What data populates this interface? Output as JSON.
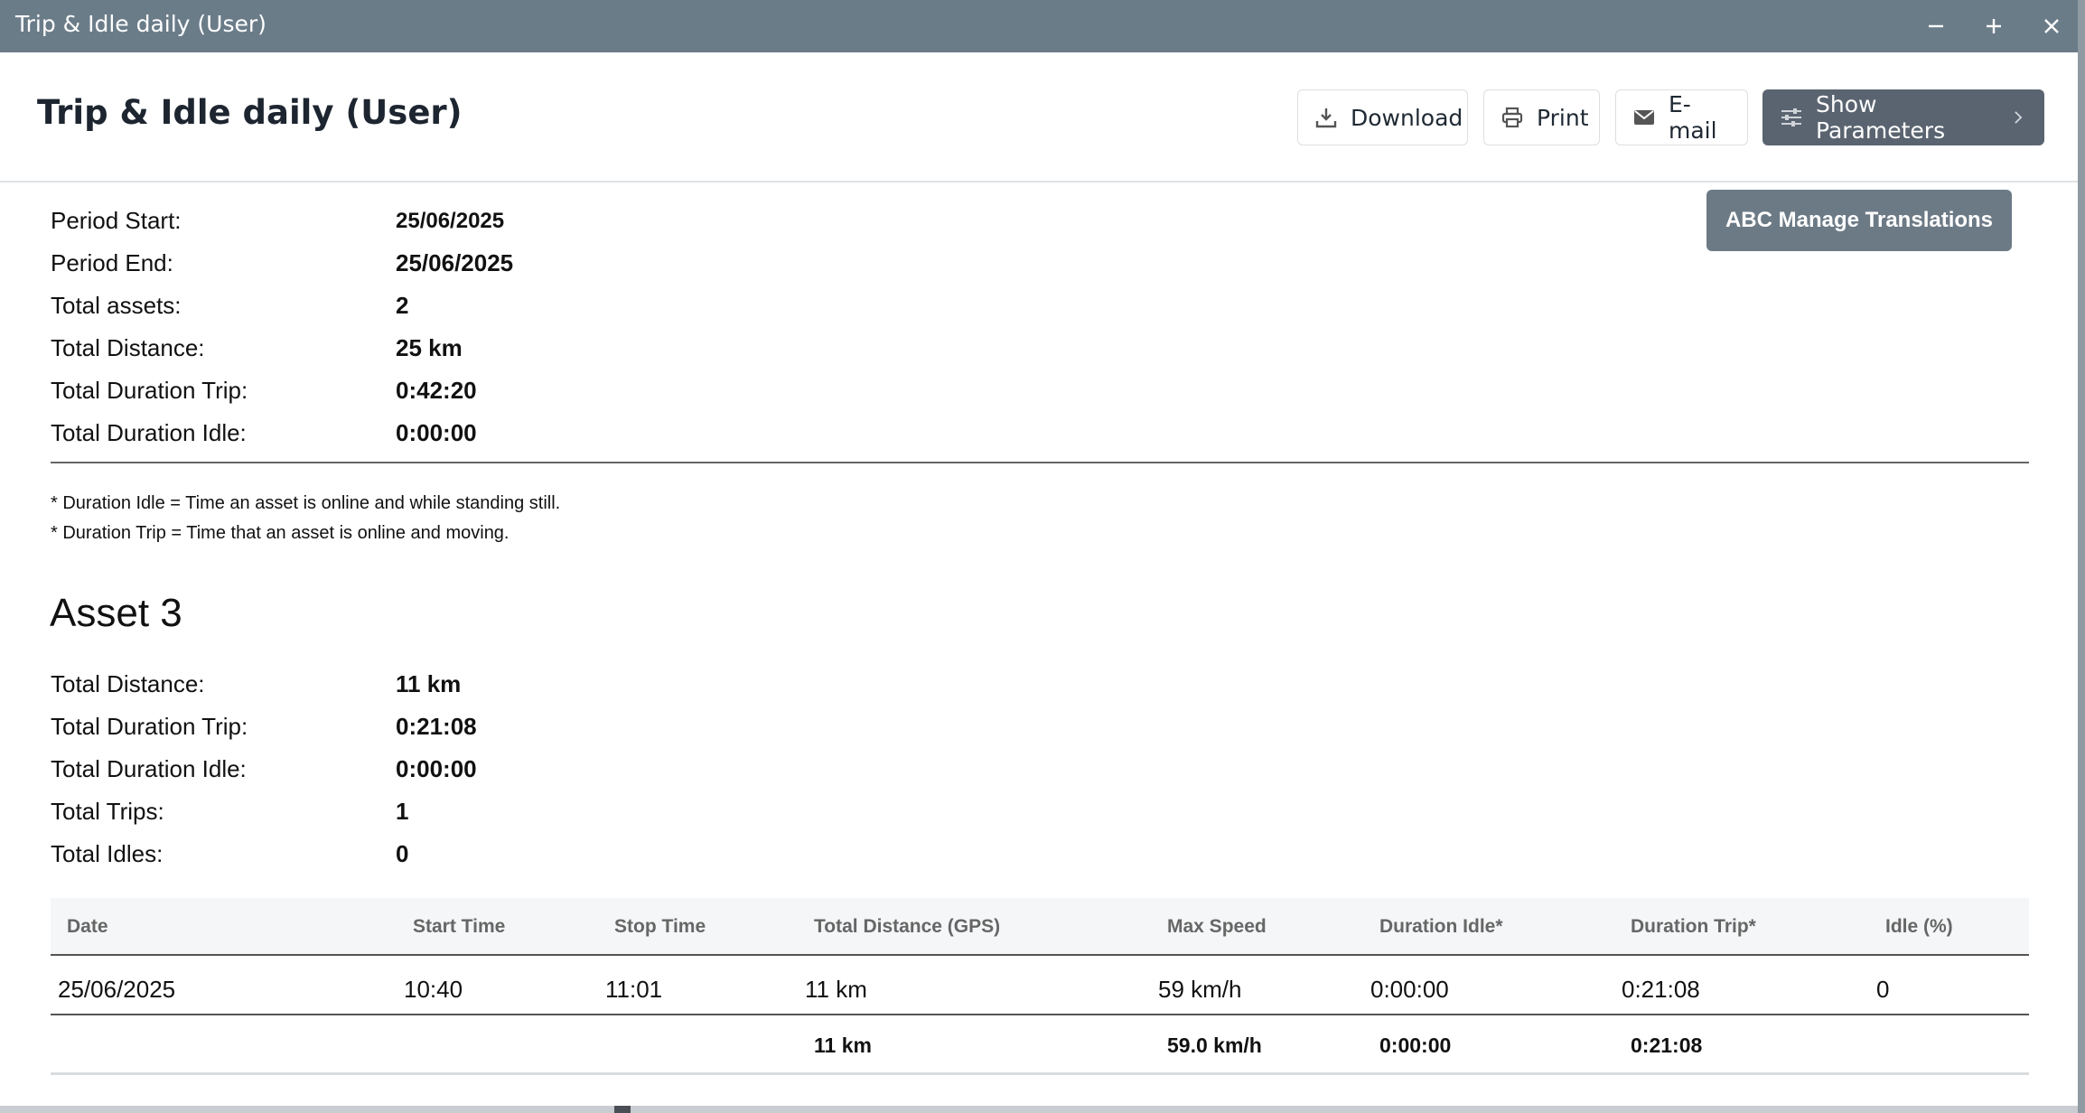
{
  "window": {
    "title": "Trip & Idle daily (User)"
  },
  "header": {
    "title": "Trip & Idle daily (User)",
    "buttons": {
      "download": "Download",
      "print": "Print",
      "email": "E-mail",
      "show_parameters": "Show Parameters"
    }
  },
  "manage_translations": "ABC Manage Translations",
  "summary": [
    {
      "label": "Period Start:",
      "value": "25/06/2025"
    },
    {
      "label": "Period End:",
      "value": "25/06/2025"
    },
    {
      "label": "Total assets:",
      "value": "2"
    },
    {
      "label": "Total Distance:",
      "value": "25 km"
    },
    {
      "label": "Total Duration Trip:",
      "value": "0:42:20"
    },
    {
      "label": "Total Duration Idle:",
      "value": "0:00:00"
    }
  ],
  "notes": [
    "* Duration Idle = Time an asset is online and while standing still.",
    "* Duration Trip = Time that an asset is online and moving."
  ],
  "asset": {
    "name": "Asset 3",
    "stats": [
      {
        "label": "Total Distance:",
        "value": "11 km"
      },
      {
        "label": "Total Duration Trip:",
        "value": "0:21:08"
      },
      {
        "label": "Total Duration Idle:",
        "value": "0:00:00"
      },
      {
        "label": "Total Trips:",
        "value": "1"
      },
      {
        "label": "Total Idles:",
        "value": "0"
      }
    ],
    "table": {
      "columns": [
        "Date",
        "Start Time",
        "Stop Time",
        "Total Distance (GPS)",
        "Max Speed",
        "Duration Idle*",
        "Duration Trip*",
        "Idle (%)"
      ],
      "rows": [
        [
          "25/06/2025",
          "10:40",
          "11:01",
          "11 km",
          "59 km/h",
          "0:00:00",
          "0:21:08",
          "0"
        ]
      ],
      "totals": [
        "",
        "",
        "",
        "11 km",
        "59.0 km/h",
        "0:00:00",
        "0:21:08",
        ""
      ]
    }
  },
  "colors": {
    "titlebar": "#6b7c89",
    "primary_button": "#5a6470",
    "translate_button": "#6c7a86"
  }
}
